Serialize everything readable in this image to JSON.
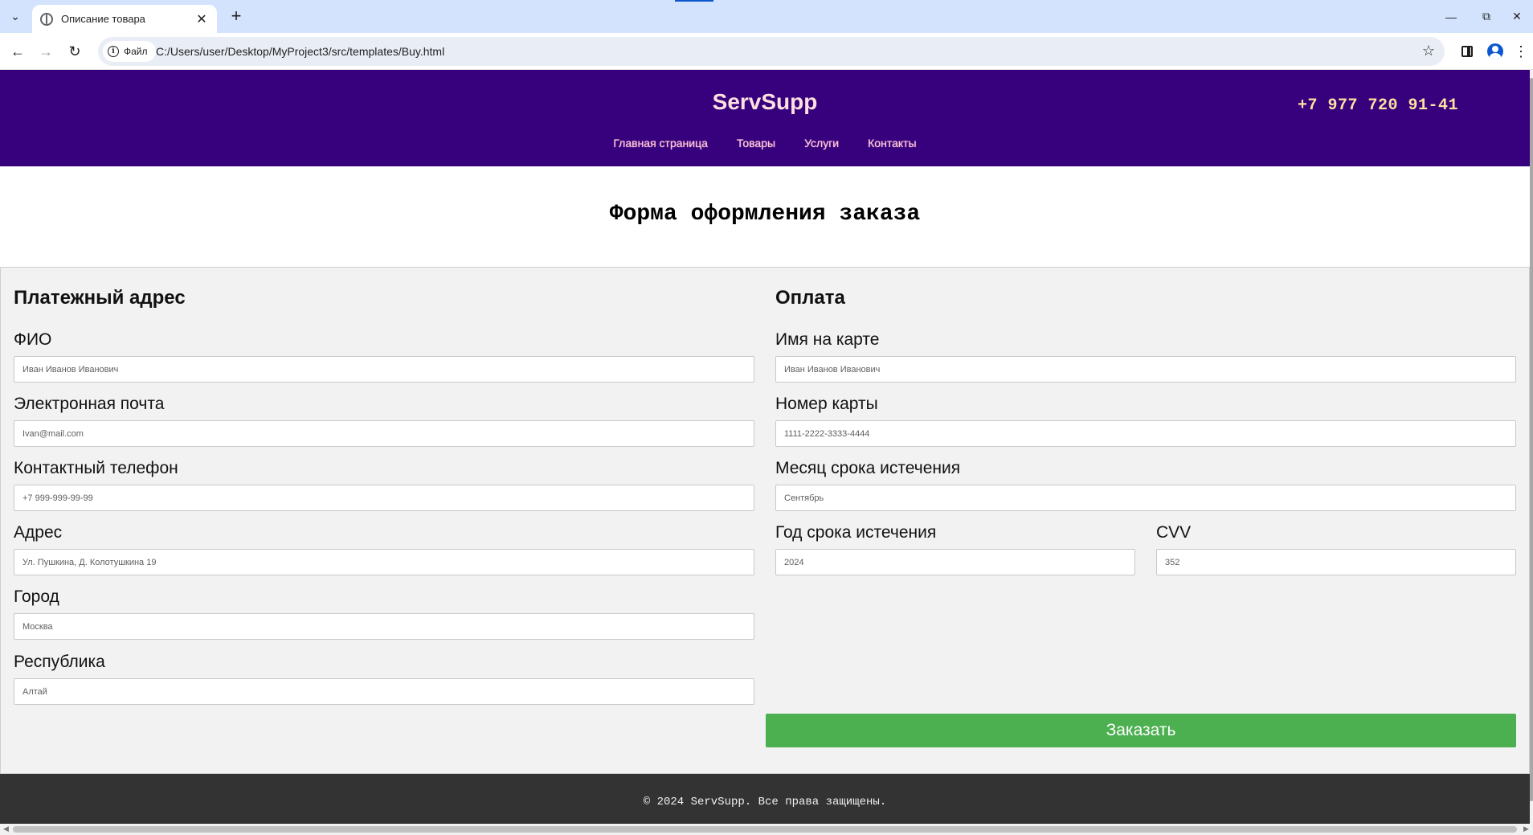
{
  "browser": {
    "tab_title": "Описание товара",
    "tab_close": "✕",
    "new_tab": "+",
    "site_chip_label": "Файл",
    "url": "C:/Users/user/Desktop/MyProject3/src/templates/Buy.html",
    "icons": {
      "tab_dropdown": "chevron-down-icon",
      "favicon": "globe-icon",
      "back": "back-arrow-icon",
      "forward": "forward-arrow-icon",
      "reload": "reload-icon",
      "info": "info-icon",
      "bookmark": "star-icon",
      "side_panel": "side-panel-icon",
      "profile": "profile-icon",
      "menu": "kebab-menu-icon",
      "minimize": "minimize-icon",
      "restore": "restore-icon",
      "close": "close-icon"
    }
  },
  "header": {
    "logo": "ServSupp",
    "phone": "+7 977 720 91-41",
    "nav": [
      {
        "label": "Главная страница"
      },
      {
        "label": "Товары"
      },
      {
        "label": "Услуги"
      },
      {
        "label": "Контакты"
      }
    ]
  },
  "main": {
    "title": "Форма оформления заказа",
    "billing": {
      "title": "Платежный адрес",
      "fields": [
        {
          "label": "ФИО",
          "placeholder": "Иван Иванов Иванович"
        },
        {
          "label": "Электронная почта",
          "placeholder": "Ivan@mail.com"
        },
        {
          "label": "Контактный телефон",
          "placeholder": "+7 999-999-99-99"
        },
        {
          "label": "Адрес",
          "placeholder": "Ул. Пушкина, Д. Колотушкина 19"
        },
        {
          "label": "Город",
          "placeholder": "Москва"
        },
        {
          "label": "Республика",
          "placeholder": "Алтай"
        }
      ]
    },
    "payment": {
      "title": "Оплата",
      "fields": [
        {
          "label": "Имя на карте",
          "placeholder": "Иван Иванов Иванович"
        },
        {
          "label": "Номер карты",
          "placeholder": "1111-2222-3333-4444"
        },
        {
          "label": "Месяц срока истечения",
          "placeholder": "Сентябрь"
        },
        {
          "label": "Год срока истечения",
          "placeholder": "2024"
        },
        {
          "label": "CVV",
          "placeholder": "352"
        }
      ]
    },
    "submit_label": "Заказать"
  },
  "footer": {
    "text": "© 2024 ServSupp. Все права защищены."
  },
  "colors": {
    "header_bg": "#37007d",
    "submit_bg": "#4caf50",
    "footer_bg": "#333333",
    "panel_bg": "#f2f2f2"
  }
}
